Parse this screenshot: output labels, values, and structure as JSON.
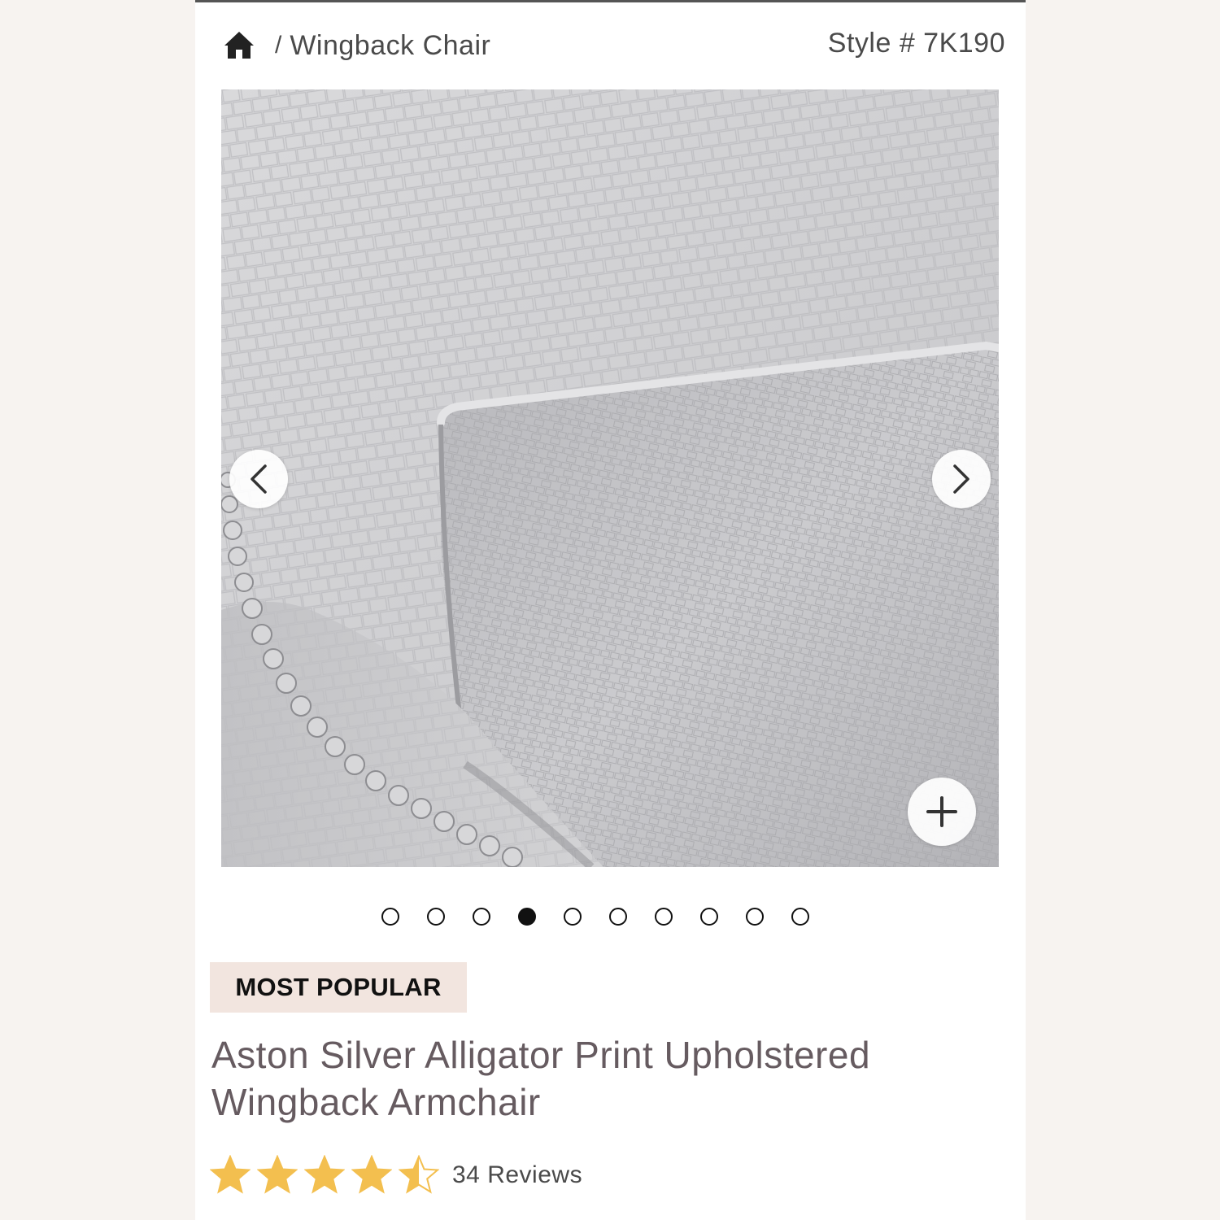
{
  "breadcrumb": {
    "home_icon": "home-icon",
    "separator": "/",
    "current": "Wingback Chair"
  },
  "style_number": "Style # 7K190",
  "gallery": {
    "prev_icon": "chevron-left-icon",
    "next_icon": "chevron-right-icon",
    "zoom_icon": "plus-icon",
    "image_count": 10,
    "active_index": 3
  },
  "badge": {
    "label": "MOST POPULAR"
  },
  "product": {
    "title_line1": "Aston Silver Alligator Print Upholstered",
    "title_line2": "Wingback Armchair"
  },
  "rating": {
    "value": 4.5,
    "max": 5,
    "reviews_label": "34 Reviews",
    "star_color": "#f3bf4f"
  },
  "colors": {
    "badge_bg": "#f2e5df",
    "title_color": "#665b60",
    "text_color": "#4a4a4a"
  }
}
